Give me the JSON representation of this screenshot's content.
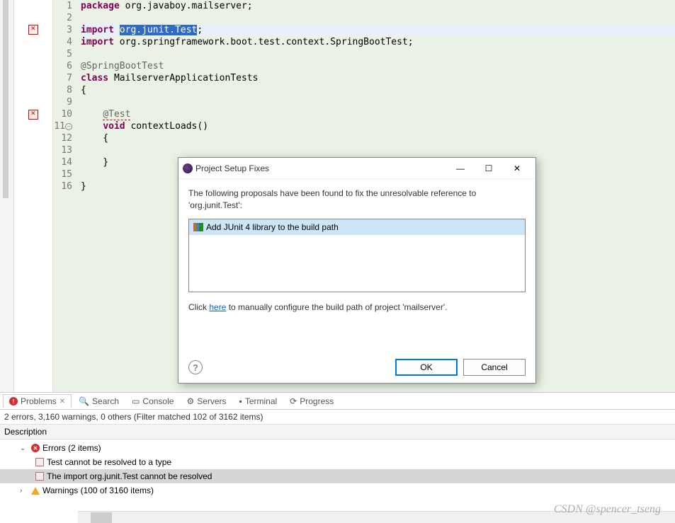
{
  "code": {
    "lines": [
      {
        "n": "1",
        "t": "package",
        "r": " org.javaboy.mailserver;",
        "kw": true
      },
      {
        "n": "2",
        "t": "",
        "r": ""
      },
      {
        "n": "3",
        "t": "import",
        "r1": " ",
        "hl": "org.junit.Test",
        "r2": ";",
        "kw": true,
        "highlight": true,
        "lineHl": true
      },
      {
        "n": "4",
        "t": "import",
        "r": " org.springframework.boot.test.context.SpringBootTest;",
        "kw": true
      },
      {
        "n": "5",
        "t": "",
        "r": ""
      },
      {
        "n": "6",
        "ann": "@SpringBootTest"
      },
      {
        "n": "7",
        "t": "class",
        "r": " MailserverApplicationTests",
        "kw": true
      },
      {
        "n": "8",
        "plain": "{"
      },
      {
        "n": "9",
        "t": "",
        "r": ""
      },
      {
        "n": "10",
        "indent": "    ",
        "annErr": "@Test",
        "gutErr": true
      },
      {
        "n": "11",
        "indent": "    ",
        "t": "void",
        "r": " contextLoads()",
        "kw": true,
        "circ": true
      },
      {
        "n": "12",
        "indent": "    ",
        "plain": "{"
      },
      {
        "n": "13",
        "t": "",
        "r": ""
      },
      {
        "n": "14",
        "indent": "    ",
        "plain": "}"
      },
      {
        "n": "15",
        "t": "",
        "r": ""
      },
      {
        "n": "16",
        "plain": "}"
      }
    ]
  },
  "dialog": {
    "title": "Project Setup Fixes",
    "message1": "The following proposals have been found to fix the unresolvable reference to",
    "message2": "'org.junit.Test':",
    "proposal": "Add JUnit 4 library to the build path",
    "click": "Click ",
    "here": "here",
    "configure": " to manually configure the build path of project 'mailserver'.",
    "ok": "OK",
    "cancel": "Cancel"
  },
  "tabs": {
    "problems": "Problems",
    "search": "Search",
    "console": "Console",
    "servers": "Servers",
    "terminal": "Terminal",
    "progress": "Progress"
  },
  "problems": {
    "filter": "2 errors, 3,160 warnings, 0 others (Filter matched 102 of 3162 items)",
    "description": "Description",
    "errors": "Errors (2 items)",
    "err1": "Test cannot be resolved to a type",
    "err2": "The import org.junit.Test cannot be resolved",
    "warnings": "Warnings (100 of 3160 items)"
  },
  "watermark": "CSDN @spencer_tseng"
}
